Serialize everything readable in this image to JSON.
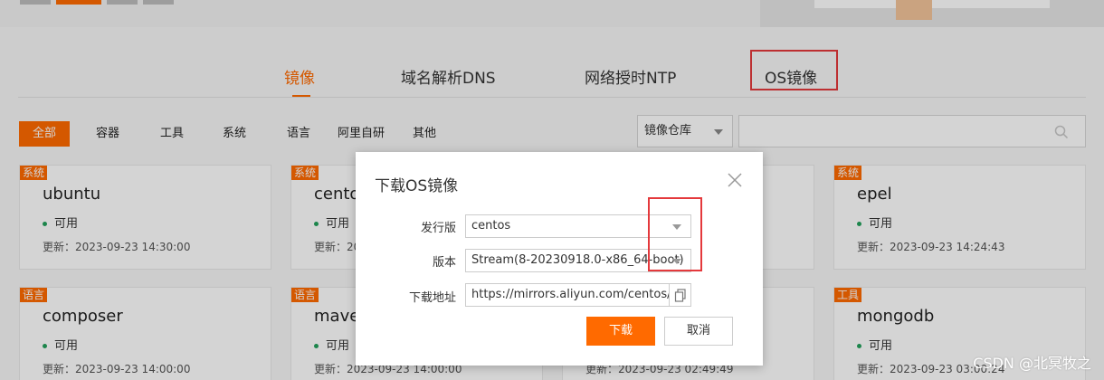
{
  "main_tabs": [
    {
      "label": "镜像",
      "active": true
    },
    {
      "label": "域名解析DNS",
      "active": false
    },
    {
      "label": "网络授时NTP",
      "active": false
    },
    {
      "label": "OS镜像",
      "active": false
    }
  ],
  "filters": [
    {
      "label": "全部",
      "active": true
    },
    {
      "label": "容器"
    },
    {
      "label": "工具"
    },
    {
      "label": "系统"
    },
    {
      "label": "语言"
    },
    {
      "label": "阿里自研"
    },
    {
      "label": "其他"
    }
  ],
  "repo_select": {
    "value": "镜像仓库"
  },
  "search": {
    "value": ""
  },
  "cards": [
    {
      "badge": "系统",
      "name": "ubuntu",
      "status": "可用",
      "updated": "更新：2023-09-23 14:30:00"
    },
    {
      "badge": "系统",
      "name": "cento",
      "status": "可用",
      "updated": "更新：2023"
    },
    {
      "badge": "系统",
      "name": "epel",
      "status": "可用",
      "updated": "更新：2023-09-23 14:24:43"
    },
    {
      "badge": "语言",
      "name": "composer",
      "status": "可用",
      "updated": "更新：2023-09-23 14:00:00"
    },
    {
      "badge": "语言",
      "name": "mave",
      "status": "可用",
      "updated": "更新：2023-09-23 14:00:00"
    },
    {
      "badge": "",
      "name": "",
      "status": "",
      "updated": "更新：2023-09-23 02:49:49"
    },
    {
      "badge": "工具",
      "name": "mongodb",
      "status": "可用",
      "updated": "更新：2023-09-23 03:00:24"
    }
  ],
  "dialog": {
    "title": "下载OS镜像",
    "distro_label": "发行版",
    "distro_value": "centos",
    "version_label": "版本",
    "version_value": "Stream(8-20230918.0-x86_64-boot)",
    "url_label": "下载地址",
    "url_value": "https://mirrors.aliyun.com/centos/8",
    "download_label": "下载",
    "cancel_label": "取消"
  },
  "watermark": "CSDN @北冥牧之",
  "colors": {
    "accent": "#ff6a00",
    "status_ok": "#22a05b",
    "highlight_box": "#e4393c"
  }
}
